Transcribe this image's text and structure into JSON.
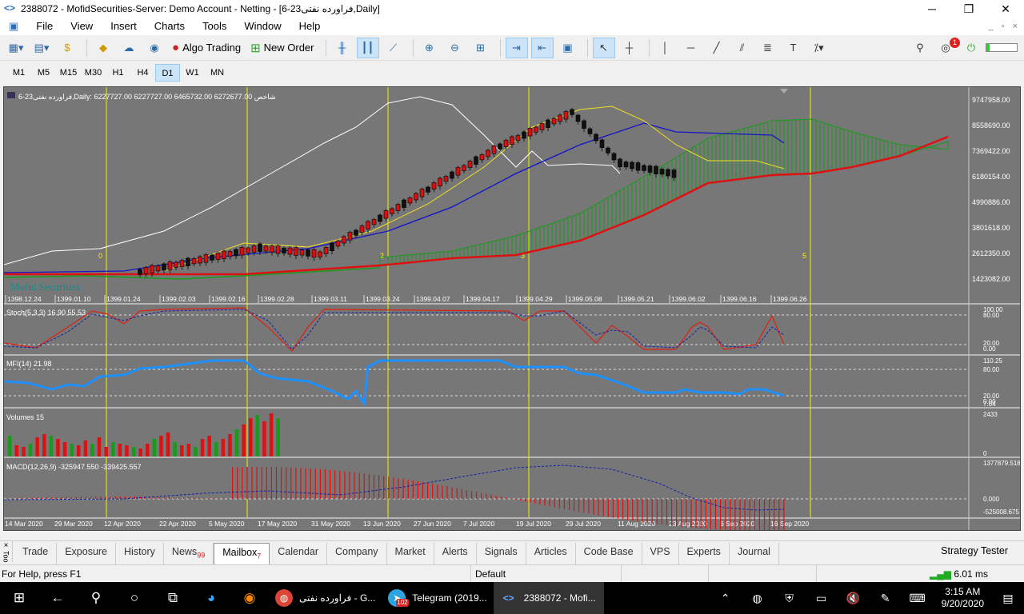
{
  "window": {
    "title": "2388072 - MofidSecurities-Server: Demo Account - Netting - [فراورده نفتی23-6,Daily]",
    "minimize": "─",
    "maximize": "❐",
    "close": "✕"
  },
  "menu": {
    "items": [
      "File",
      "View",
      "Insert",
      "Charts",
      "Tools",
      "Window",
      "Help"
    ]
  },
  "toolbar": {
    "algo_trading": "Algo Trading",
    "new_order": "New Order",
    "notif_count": "1"
  },
  "timeframes": {
    "items": [
      "M1",
      "M5",
      "M15",
      "M30",
      "H1",
      "H4",
      "D1",
      "W1",
      "MN"
    ],
    "selected": "D1"
  },
  "chart": {
    "header": "فراورده نفتی23-6,Daily:  6227727.00 6227727.00 6465732.00 6272677.00  شاخص",
    "watermark": "Mofid Securities",
    "price_ticks": [
      "9747958.00",
      "8558690.00",
      "7369422.00",
      "6180154.00",
      "4990886.00",
      "3801618.00",
      "2612350.00",
      "1423082.00"
    ],
    "date_ticks_top": [
      "1398.12.24",
      "1399.01.10",
      "1399.01.24",
      "1399.02.03",
      "1399.02.16",
      "1399.02.28",
      "1399.03.11",
      "1399.03.24",
      "1399.04.07",
      "1399.04.17",
      "1399.04.29",
      "1399.05.08",
      "1399.05.21",
      "1399.06.02",
      "1399.06.16",
      "1399.06.26"
    ],
    "date_ticks_bottom": [
      "14 Mar 2020",
      "29 Mar 2020",
      "12 Apr 2020",
      "22 Apr 2020",
      "5 May 2020",
      "17 May 2020",
      "31 May 2020",
      "13 Jun 2020",
      "27 Jun 2020",
      "7 Jul 2020",
      "19 Jul 2020",
      "29 Jul 2020",
      "11 Aug 2020",
      "23 Aug 2020",
      "6 Sep 2020",
      "16 Sep 2020"
    ],
    "period_labels": [
      "0",
      "2",
      "3",
      "5"
    ],
    "stoch": {
      "label": "Stoch(5,3,3) 16.90 55.53",
      "ticks": [
        "100.00",
        "80.00",
        "20.00",
        "0.00"
      ]
    },
    "mfi": {
      "label": "MFI(14) 21.98",
      "ticks": [
        "110.25",
        "80.00",
        "20.00",
        "0.00"
      ],
      "extra_tick": "7.04"
    },
    "volumes": {
      "label": "Volumes 15",
      "ticks": [
        "2433",
        "0"
      ]
    },
    "macd": {
      "label": "MACD(12,26,9) -325947.550 -339425.557",
      "ticks": [
        "1377879.518",
        "0.000",
        "-525008.675"
      ]
    },
    "colors": {
      "bg": "#777777",
      "up": "#1a9a1a",
      "down": "#dd1111",
      "mfi": "#1e90ff",
      "grid": "#f5f500"
    }
  },
  "tabs": {
    "items": [
      {
        "label": "Trade"
      },
      {
        "label": "Exposure"
      },
      {
        "label": "History"
      },
      {
        "label": "News",
        "badge": "99"
      },
      {
        "label": "Mailbox",
        "badge": "7"
      },
      {
        "label": "Calendar"
      },
      {
        "label": "Company"
      },
      {
        "label": "Market"
      },
      {
        "label": "Alerts"
      },
      {
        "label": "Signals"
      },
      {
        "label": "Articles"
      },
      {
        "label": "Code Base"
      },
      {
        "label": "VPS"
      },
      {
        "label": "Experts"
      },
      {
        "label": "Journal"
      }
    ],
    "selected": "Mailbox",
    "strategy_tester": "Strategy Tester",
    "side_label": "Toolbox"
  },
  "status": {
    "help": "For Help, press F1",
    "profile": "Default",
    "ping": "6.01 ms"
  },
  "taskbar": {
    "apps": [
      {
        "label": "فراورده نفتی - G...",
        "icon": "chrome-icon"
      },
      {
        "label": "Telegram (2019...",
        "icon": "telegram-icon",
        "badge": "102"
      },
      {
        "label": "2388072 - Mofi...",
        "icon": "metatrader-icon"
      }
    ],
    "time": "3:15 AM",
    "date": "9/20/2020"
  }
}
